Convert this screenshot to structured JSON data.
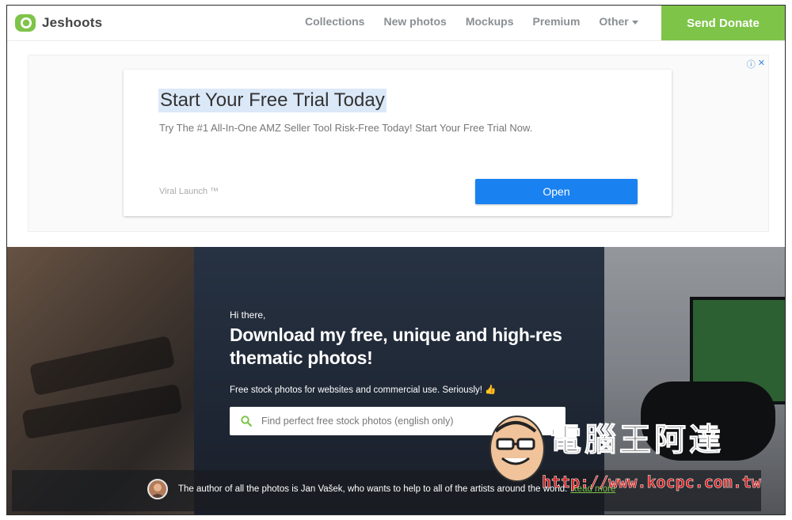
{
  "nav": {
    "brand": "Jeshoots",
    "links": [
      {
        "label": "Collections"
      },
      {
        "label": "New photos"
      },
      {
        "label": "Mockups"
      },
      {
        "label": "Premium"
      },
      {
        "label": "Other"
      }
    ],
    "donate_label": "Send Donate"
  },
  "ad": {
    "title": "Start Your Free Trial Today",
    "description": "Try The #1 All-In-One AMZ Seller Tool Risk-Free Today! Start Your Free Trial Now.",
    "brand": "Viral Launch ™",
    "cta_label": "Open",
    "info_icon": "ⓘ",
    "close_icon": "✕"
  },
  "hero": {
    "greeting": "Hi there,",
    "title": "Download my free, unique and high-res thematic photos!",
    "subtitle": "Free stock photos for websites and commercial use. Seriously! 👍",
    "search_placeholder": "Find perfect free stock photos (english only)",
    "credit_text": "The author of all the photos is Jan Vašek, who wants to help to all of the artists around the world.",
    "read_more": "Read more"
  },
  "watermark": {
    "title": "電腦王阿達",
    "url": "http://www.kocpc.com.tw"
  },
  "colors": {
    "brand_green": "#7dc448",
    "ad_button_blue": "#1a82f0",
    "nav_text": "#8a8f93"
  }
}
